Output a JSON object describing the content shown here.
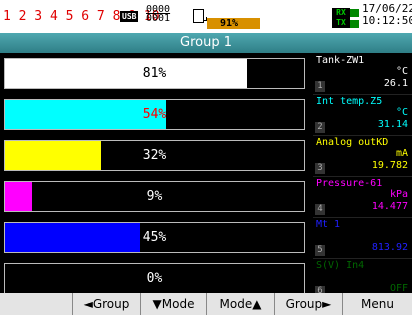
{
  "status": {
    "channel_numbers": "1 2 3 4 5 6 7 8 9 10",
    "usb_label": "USB",
    "counter_top": "0000",
    "counter_bottom": "0001",
    "memory_percent": "91%",
    "rx_label": "RX",
    "tx_label": "TX",
    "date": "17/06/22",
    "time": "10:12:50"
  },
  "group": {
    "title": "Group 1"
  },
  "bars": [
    {
      "label": "81%",
      "fraction": 0.81,
      "color": "#ffffff"
    },
    {
      "label": "54%",
      "fraction": 0.54,
      "color": "#00ffff"
    },
    {
      "label": "32%",
      "fraction": 0.32,
      "color": "#ffff00"
    },
    {
      "label": "9%",
      "fraction": 0.09,
      "color": "#ff00ff"
    },
    {
      "label": "45%",
      "fraction": 0.45,
      "color": "#0000ff"
    },
    {
      "label": "0%",
      "fraction": 0.0,
      "color": "#00aa00"
    }
  ],
  "channels": [
    {
      "number": "1",
      "name": "Tank-ZW1",
      "unit": "°C",
      "value": "26.1",
      "color": "#ffffff"
    },
    {
      "number": "2",
      "name": "Int temp.Z5",
      "unit": "°C",
      "value": "31.14",
      "color": "#00ffff"
    },
    {
      "number": "3",
      "name": "Analog outKD",
      "unit": "mA",
      "value": "19.782",
      "color": "#ffff00"
    },
    {
      "number": "4",
      "name": "Pressure-61",
      "unit": "kPa",
      "value": "14.477",
      "color": "#ff00ff"
    },
    {
      "number": "5",
      "name": "Mt 1",
      "unit": "",
      "value": "813.92",
      "color": "#0000ff"
    },
    {
      "number": "6",
      "name": "S(V) In4",
      "unit": "",
      "value": "OFF",
      "color": "#006600"
    }
  ],
  "function_keys": [
    "",
    "◄Group",
    "▼Mode",
    "Mode▲",
    "Group►",
    "Menu"
  ]
}
